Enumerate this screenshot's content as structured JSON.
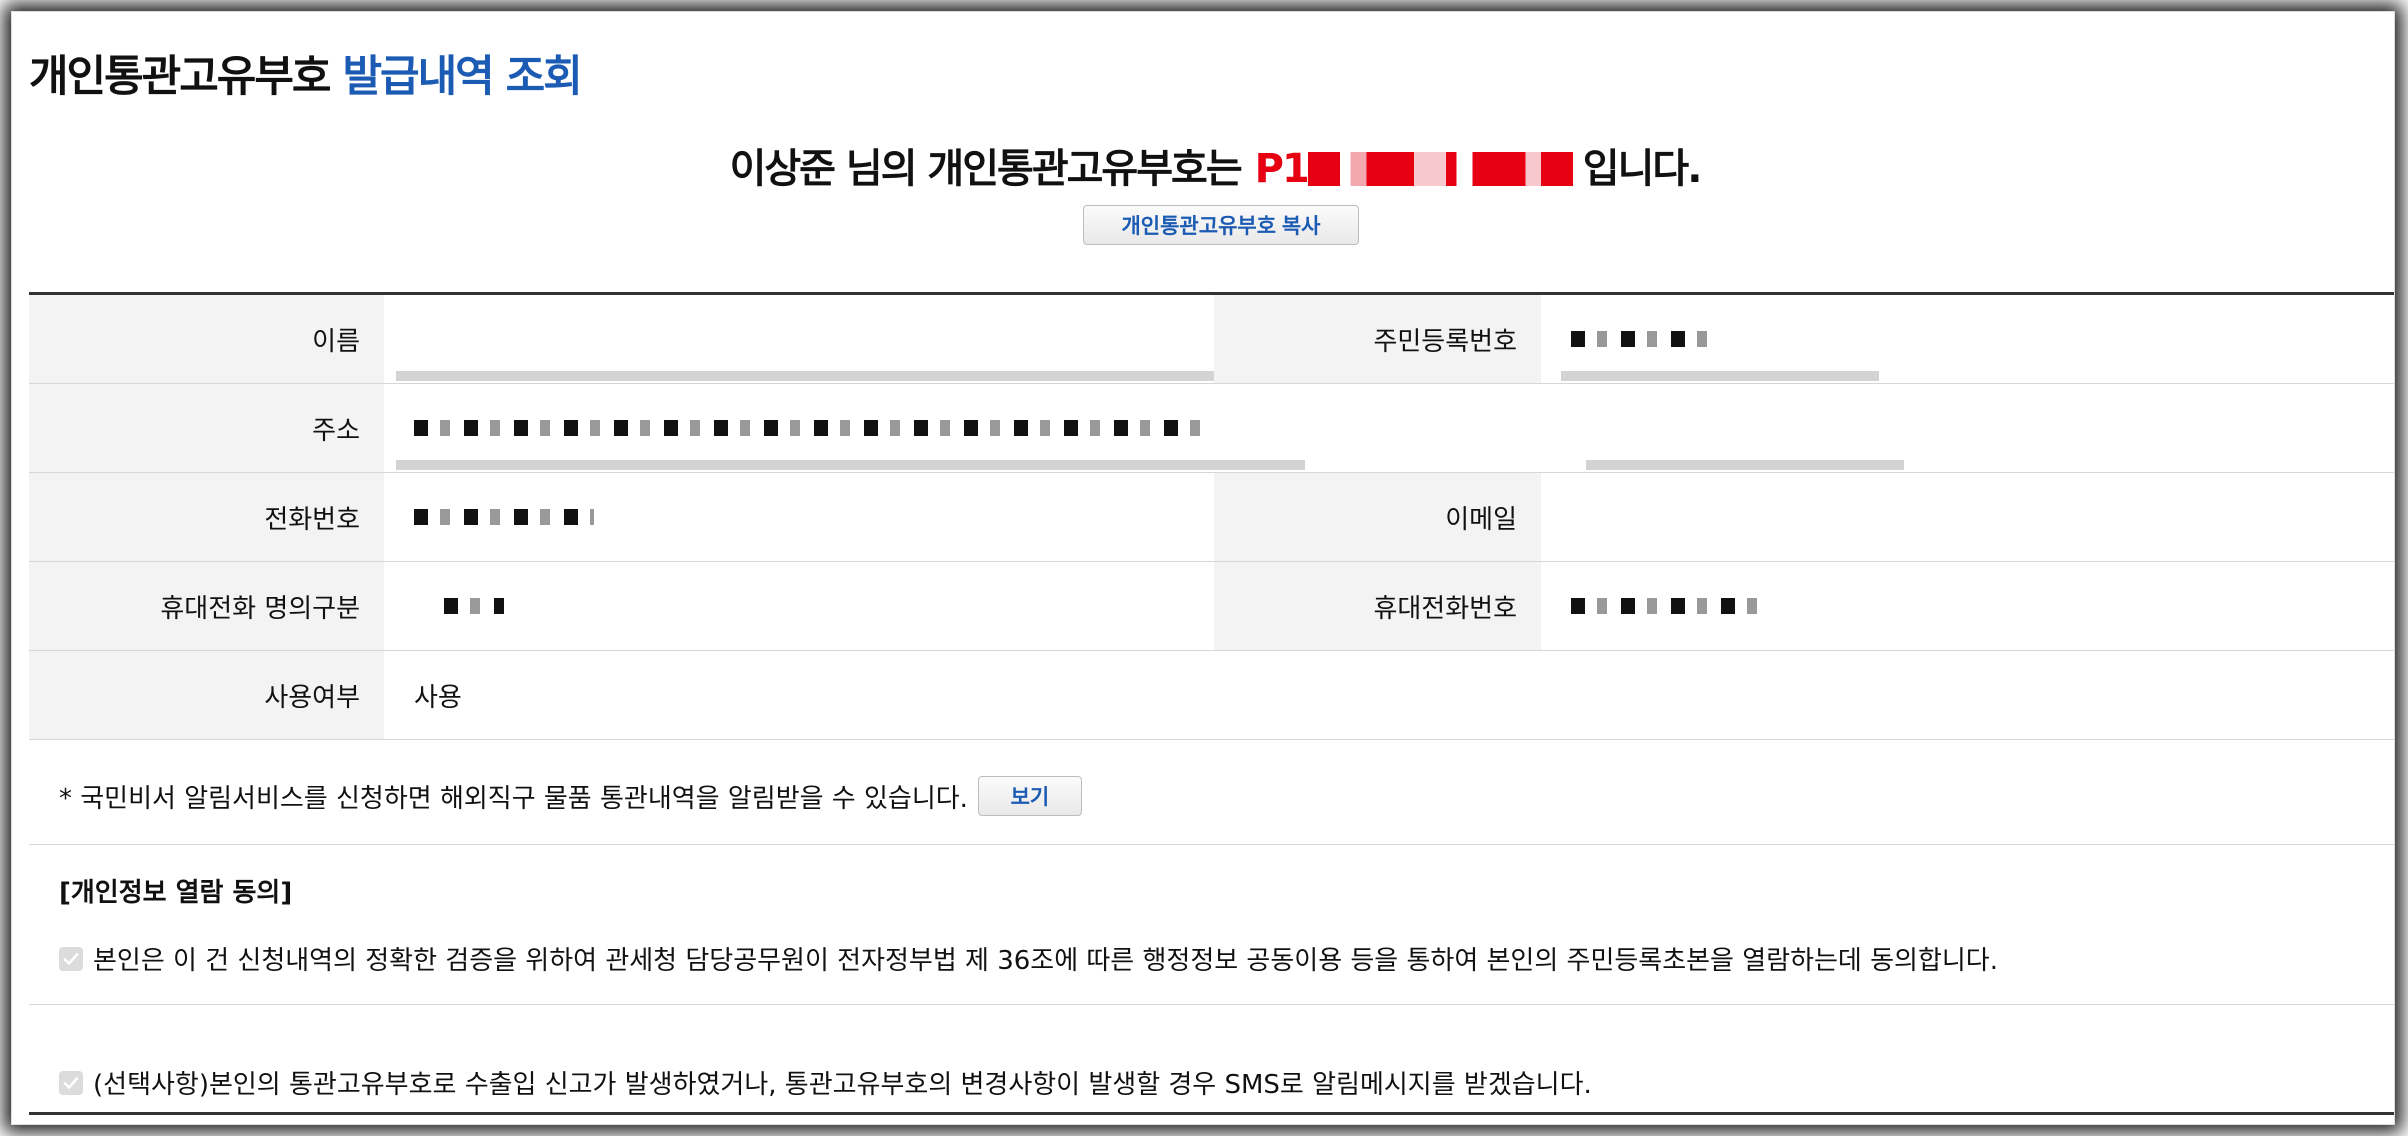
{
  "page": {
    "title_main": "개인통관고유부호",
    "title_accent": "발급내역 조회"
  },
  "headline": {
    "prefix": "이상준 님의 개인통관고유부호는",
    "code_visible": "P1",
    "suffix": "입니다."
  },
  "copy_button_label": "개인통관고유부호 복사",
  "table": {
    "name_label": "이름",
    "rrn_label": "주민등록번호",
    "address_label": "주소",
    "phone_label": "전화번호",
    "email_label": "이메일",
    "mobile_owner_label": "휴대전화 명의구분",
    "mobile_label": "휴대전화번호",
    "usage_label": "사용여부",
    "usage_value": "사용"
  },
  "notice": {
    "text": "* 국민비서 알림서비스를 신청하면 해외직구 물품 통관내역을 알림받을 수 있습니다.",
    "view_button": "보기"
  },
  "consent": {
    "title": "[개인정보 열람 동의]",
    "item1": "본인은 이 건 신청내역의 정확한 검증을 위하여 관세청 담당공무원이 전자정부법 제 36조에 따른 행정정보 공동이용 등을 통하여 본인의 주민등록초본을 열람하는데 동의합니다.",
    "item2": "(선택사항)본인의 통관고유부호로 수출입 신고가 발생하였거나, 통관고유부호의 변경사항이 발생할 경우 SMS로 알림메시지를 받겠습니다.",
    "item1_checked": true,
    "item2_checked": true
  },
  "colors": {
    "accent_blue": "#1c5bb3",
    "code_red": "#e60012"
  }
}
